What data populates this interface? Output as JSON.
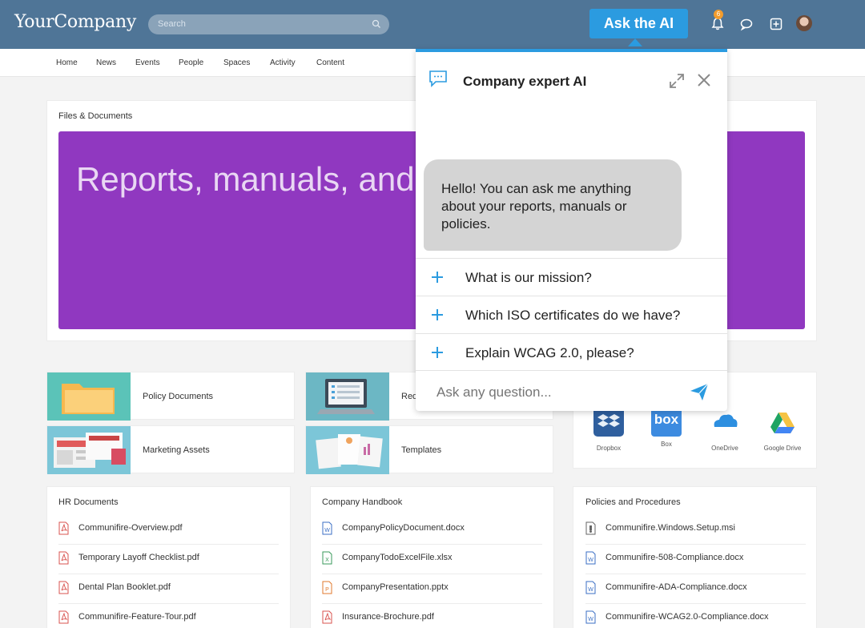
{
  "header": {
    "logo": "YourCompany",
    "search_placeholder": "Search",
    "ask_button": "Ask the AI",
    "notification_count": "6",
    "colors": {
      "header_bg": "#4f7597",
      "accent": "#2b9be0",
      "banner": "#9038c0"
    },
    "icons": [
      "search-icon",
      "bell-icon",
      "chat-bubble-icon",
      "plus-square-icon",
      "user-avatar"
    ]
  },
  "nav": {
    "items": [
      "Home",
      "News",
      "Events",
      "People",
      "Spaces",
      "Activity",
      "Content"
    ]
  },
  "files_documents": {
    "title": "Files & Documents",
    "banner_text": "Reports, manuals, and"
  },
  "tiles": [
    {
      "label": "Policy Documents"
    },
    {
      "label": "Req"
    },
    {
      "label": "Marketing Assets"
    },
    {
      "label": "Templates"
    }
  ],
  "cloud_storage": [
    {
      "label": "Dropbox",
      "logo_text": ""
    },
    {
      "label": "Box",
      "logo_text": "box"
    },
    {
      "label": "OneDrive",
      "logo_text": ""
    },
    {
      "label": "Google Drive",
      "logo_text": ""
    }
  ],
  "hr_documents": {
    "title": "HR Documents",
    "files": [
      {
        "name": "Communifire-Overview.pdf",
        "type": "pdf"
      },
      {
        "name": "Temporary Layoff Checklist.pdf",
        "type": "pdf"
      },
      {
        "name": "Dental Plan Booklet.pdf",
        "type": "pdf"
      },
      {
        "name": "Communifire-Feature-Tour.pdf",
        "type": "pdf"
      }
    ]
  },
  "company_handbook": {
    "title": "Company Handbook",
    "files": [
      {
        "name": "CompanyPolicyDocument.docx",
        "type": "docx"
      },
      {
        "name": "CompanyTodoExcelFile.xlsx",
        "type": "xlsx"
      },
      {
        "name": "CompanyPresentation.pptx",
        "type": "pptx"
      },
      {
        "name": "Insurance-Brochure.pdf",
        "type": "pdf"
      }
    ]
  },
  "policies_procedures": {
    "title": "Policies and Procedures",
    "files": [
      {
        "name": "Communifire.Windows.Setup.msi",
        "type": "msi"
      },
      {
        "name": "Communifire-508-Compliance.docx",
        "type": "docx"
      },
      {
        "name": "Communifire-ADA-Compliance.docx",
        "type": "docx"
      },
      {
        "name": "Communifire-WCAG2.0-Compliance.docx",
        "type": "docx"
      }
    ]
  },
  "ai_panel": {
    "title": "Company expert AI",
    "greeting": "Hello! You can ask me anything about your reports, manuals or policies.",
    "suggestions": [
      "What is our mission?",
      "Which ISO certificates do we have?",
      "Explain WCAG 2.0, please?"
    ],
    "input_placeholder": "Ask any question..."
  }
}
